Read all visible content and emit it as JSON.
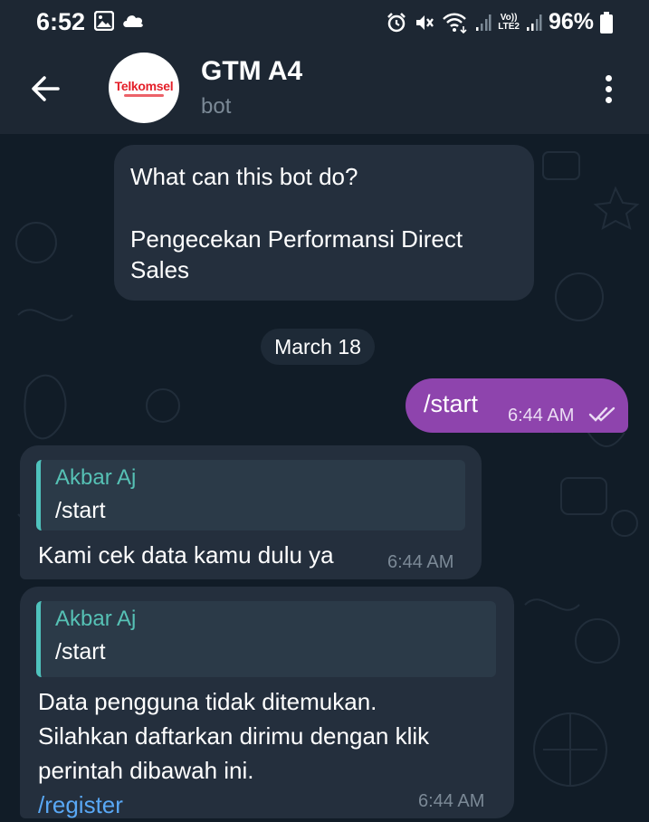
{
  "status_bar": {
    "time": "6:52",
    "lte_label_top": "Vo))",
    "lte_label_bottom": "LTE2",
    "battery": "96%"
  },
  "header": {
    "title": "GTM A4",
    "subtitle": "bot",
    "avatar_brand": "Telkomsel",
    "brand_color": "#e4202a"
  },
  "chat": {
    "bot_info": {
      "question": "What can this bot do?",
      "description": "Pengecekan Performansi Direct Sales"
    },
    "date_separator": "March 18",
    "outgoing": {
      "text": "/start",
      "time": "6:44 AM",
      "status_icon": "double-check-icon",
      "bubble_color": "#8e44ad"
    },
    "incoming": [
      {
        "reply_to_name": "Akbar Aj",
        "reply_to_text": "/start",
        "text": "Kami cek data kamu dulu ya",
        "time": "6:44 AM"
      },
      {
        "reply_to_name": "Akbar Aj",
        "reply_to_text": "/start",
        "text_line1": "Data pengguna tidak ditemukan.",
        "text_line2": "Silahkan daftarkan dirimu dengan klik",
        "text_line3": "perintah dibawah ini.",
        "command_link": "/register",
        "time": "6:44 AM"
      }
    ]
  },
  "icons": {
    "back": "arrow-left-icon",
    "menu": "more-vertical-icon",
    "status": [
      "image-icon",
      "cloud-icon",
      "alarm-icon",
      "mute-icon",
      "wifi-icon",
      "signal-icon",
      "battery-icon"
    ]
  },
  "colors": {
    "background": "#111c27",
    "bar": "#1d2733",
    "bubble_in": "#242f3d",
    "reply_accent": "#4fc3bd",
    "link": "#59a8f5"
  }
}
